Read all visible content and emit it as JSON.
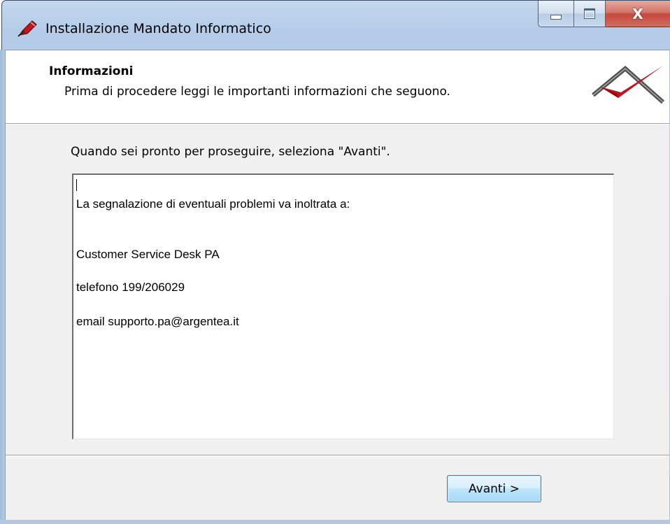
{
  "window": {
    "title": "Installazione Mandato Informatico",
    "icon": "pen-icon"
  },
  "caption_buttons": {
    "minimize_icon": "minimize-icon",
    "maximize_icon": "maximize-icon",
    "close_icon": "close-icon",
    "close_glyph": "X"
  },
  "header": {
    "title": "Informazioni",
    "subtitle": "Prima di procedere leggi le importanti informazioni che seguono.",
    "logo_icon": "checkmark-logo-icon"
  },
  "main": {
    "prompt": "Quando sei pronto per proseguire, seleziona \"Avanti\".",
    "info_lines": [
      "La segnalazione di eventuali problemi va inoltrata a:",
      "Customer Service Desk PA",
      "telefono 199/206029",
      "email supporto.pa@argentea.it"
    ]
  },
  "footer": {
    "next_label": "Avanti >"
  },
  "colors": {
    "title_bar": "#b5cde8",
    "client_bg": "#f0f0f0",
    "logo_check": "#c0141e",
    "button_border": "#3c7fb1"
  }
}
